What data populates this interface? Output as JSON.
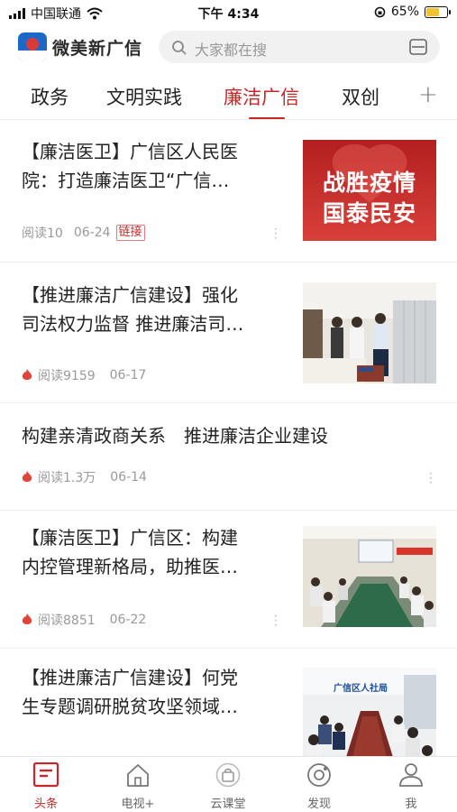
{
  "status_bar": {
    "carrier": "中国联通",
    "time": "下午 4:34",
    "battery": "65%",
    "battery_level": 0.65
  },
  "header": {
    "app_name": "微美新广信",
    "search_placeholder": "大家都在搜"
  },
  "tabs": [
    {
      "label": "政务",
      "active": false
    },
    {
      "label": "文明实践",
      "active": false
    },
    {
      "label": "廉洁广信",
      "active": true
    },
    {
      "label": "双创",
      "active": false
    }
  ],
  "articles": [
    {
      "title_line1": "【廉洁医卫】广信区人民医",
      "title_line2": "院：打造廉洁医卫“广信…",
      "reads": "阅读10",
      "date": "06-24",
      "badge": "链接",
      "image_text_1": "战胜疫情",
      "image_text_2": "国泰民安"
    },
    {
      "title_line1": "【推进廉洁广信建设】强化",
      "title_line2": "司法权力监督 推进廉洁司…",
      "reads": "阅读9159",
      "date": "06-17"
    },
    {
      "title_line1": "构建亲清政商关系　推进廉洁企业建设",
      "reads": "阅读1.3万",
      "date": "06-14"
    },
    {
      "title_line1": "【廉洁医卫】广信区：构建",
      "title_line2": "内控管理新格局，助推医…",
      "reads": "阅读8851",
      "date": "06-22"
    },
    {
      "title_line1": "【推进廉洁广信建设】何党",
      "title_line2": "生专题调研脱贫攻坚领域…",
      "image_text_1": "广信区人社局"
    }
  ],
  "bottom_nav": [
    {
      "label": "头条",
      "icon": "headline-icon",
      "active": true
    },
    {
      "label": "电视+",
      "icon": "home-icon",
      "active": false
    },
    {
      "label": "云课堂",
      "icon": "bag-icon",
      "active": false
    },
    {
      "label": "发现",
      "icon": "discover-icon",
      "active": false
    },
    {
      "label": "我",
      "icon": "user-icon",
      "active": false
    }
  ],
  "colors": {
    "accent": "#c8272a",
    "brand_blue": "#1d67c6"
  }
}
